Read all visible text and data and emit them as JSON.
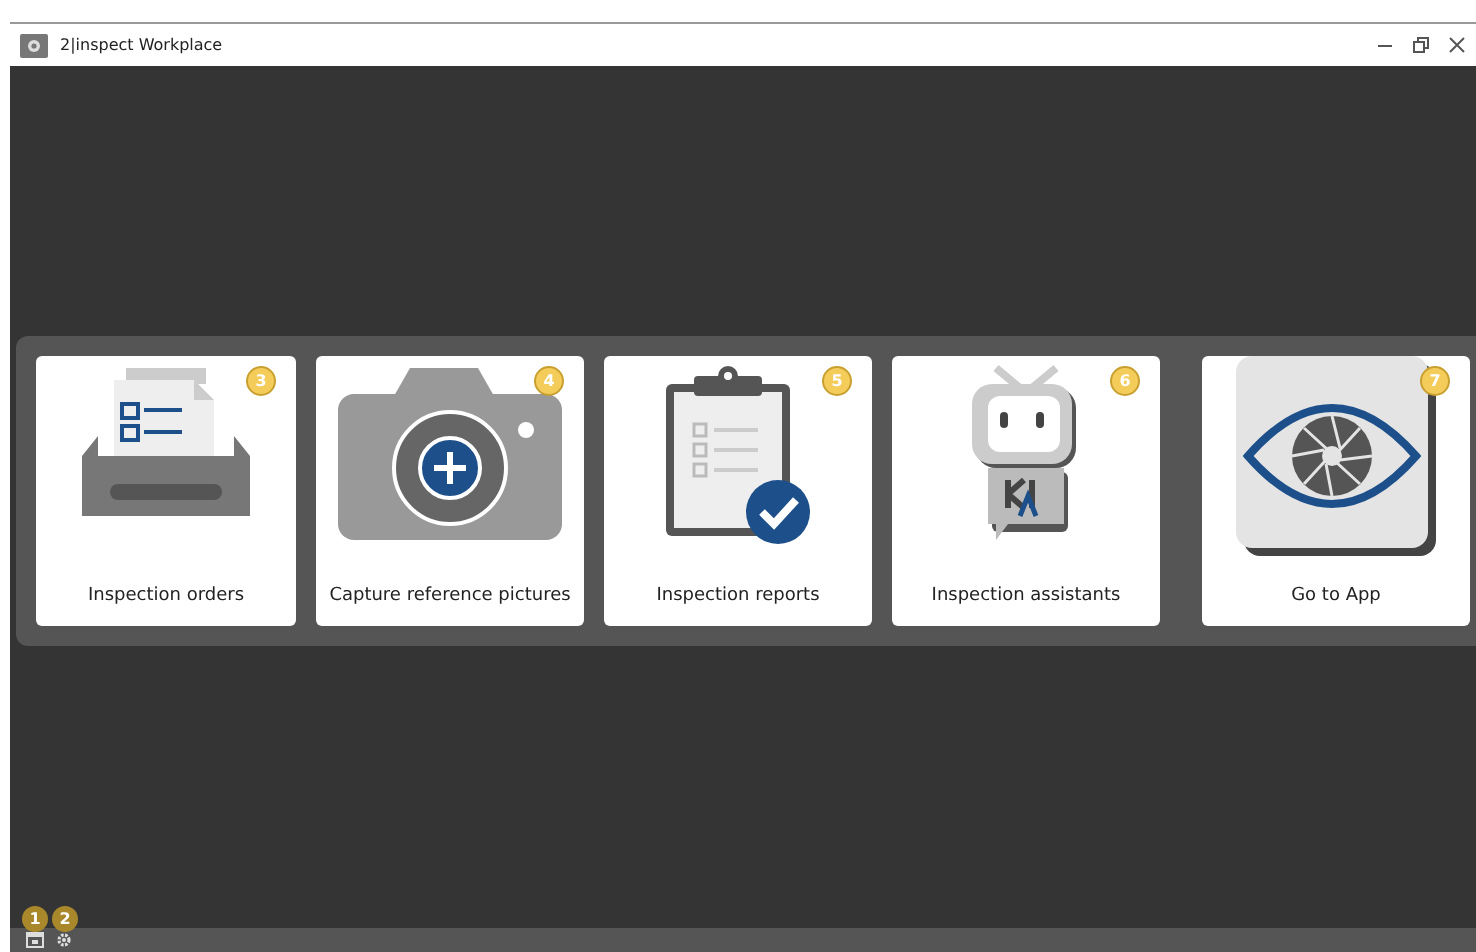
{
  "window": {
    "title": "2|inspect Workplace"
  },
  "tiles": [
    {
      "kind": "orders",
      "label": "Inspection orders",
      "badge": "3"
    },
    {
      "kind": "camera",
      "label": "Capture reference pictures",
      "badge": "4"
    },
    {
      "kind": "reports",
      "label": "Inspection reports",
      "badge": "5"
    },
    {
      "kind": "assistant",
      "label": "Inspection assistants",
      "badge": "6"
    },
    {
      "kind": "app",
      "label": "Go to App",
      "badge": "7"
    }
  ],
  "status_bar": {
    "items": [
      {
        "kind": "calendar",
        "badge": "1"
      },
      {
        "kind": "settings",
        "badge": "2"
      }
    ]
  }
}
